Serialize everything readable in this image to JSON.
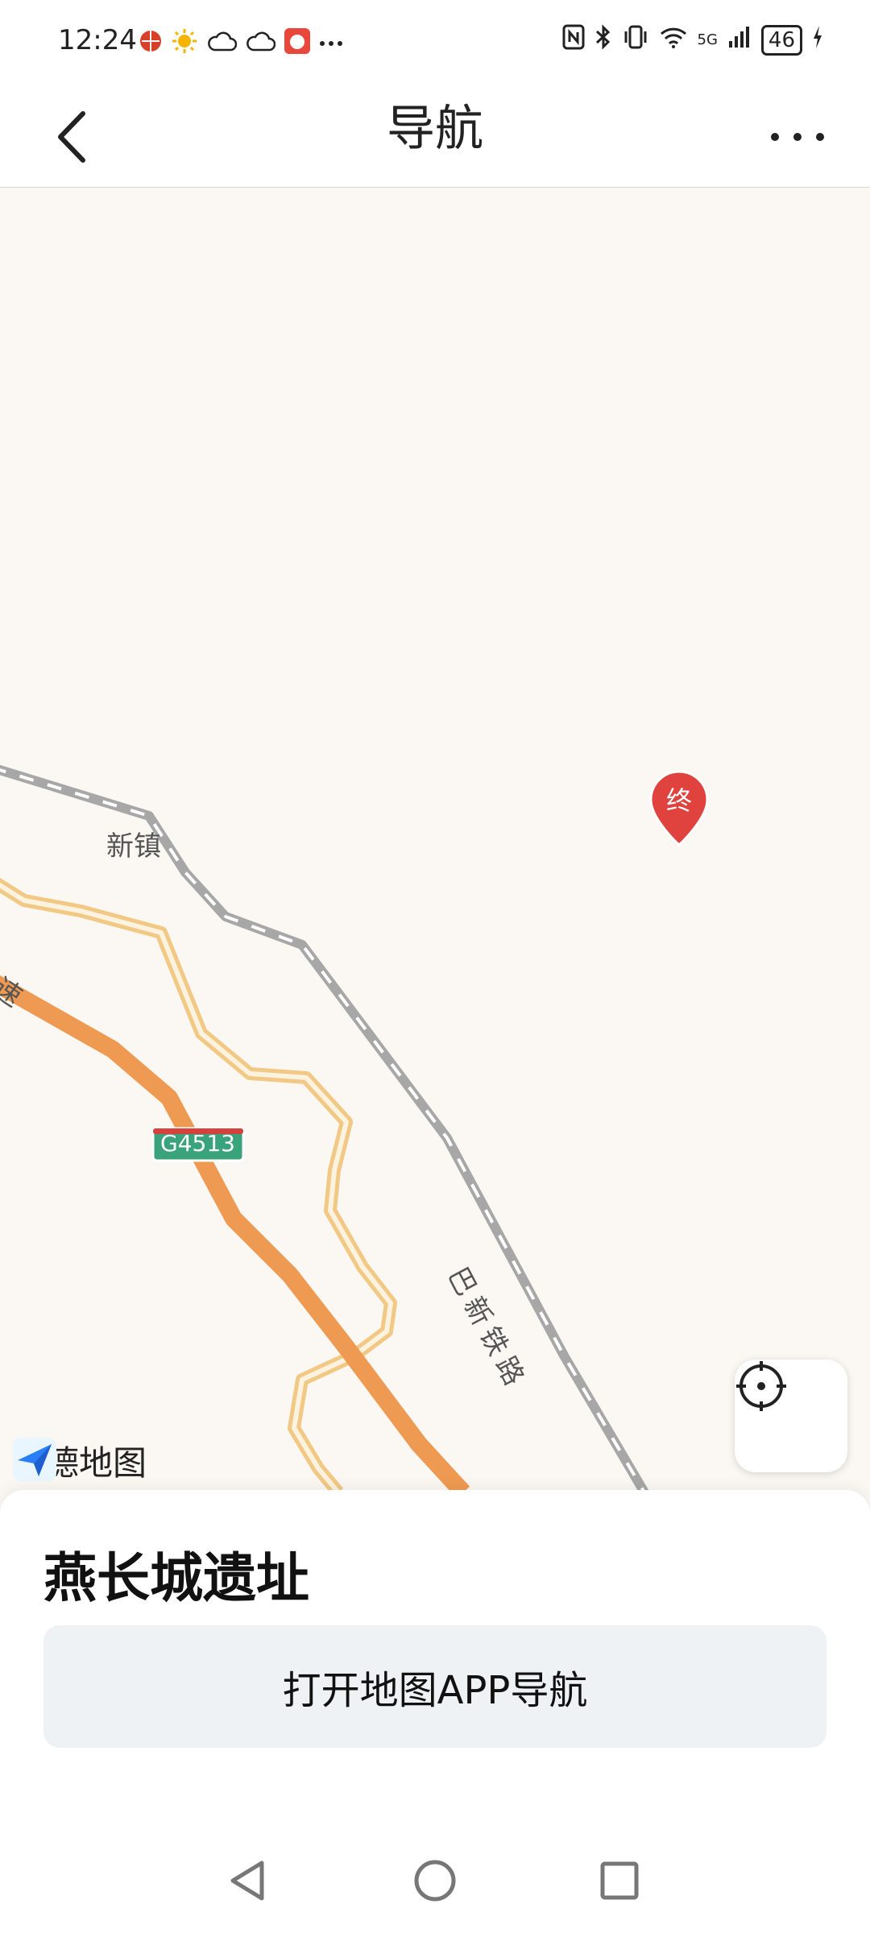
{
  "status_bar": {
    "time": "12:24",
    "network": "5G",
    "battery": "46"
  },
  "app_bar": {
    "title": "导航"
  },
  "map": {
    "labels": {
      "town": "新镇",
      "railway": "巴新铁路",
      "highway_shield": "G4513",
      "expressway_fragment": "速"
    },
    "end_marker": "终",
    "provider": "高德地图",
    "colors": {
      "expressway": "#ef9a52",
      "road": "#f2c984",
      "railway": "#a7a7a7",
      "shield_green": "#3aa37b",
      "marker_red": "#e0423d",
      "background": "#fbf8f3"
    }
  },
  "sheet": {
    "place_name": "燕长城遗址",
    "open_nav_button": "打开地图APP导航"
  }
}
